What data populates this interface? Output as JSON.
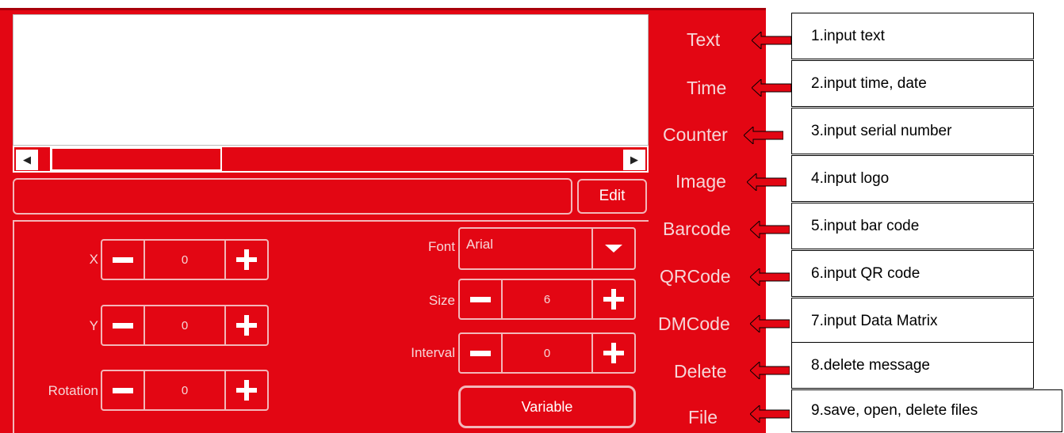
{
  "editor": {
    "scroll_left_icon": "left-arrow-icon",
    "scroll_right_icon": "right-arrow-icon",
    "edit_label": "Edit"
  },
  "props": {
    "x_label": "X",
    "x_value": "0",
    "y_label": "Y",
    "y_value": "0",
    "rotation_label": "Rotation",
    "rotation_value": "0",
    "font_label": "Font",
    "font_value": "Arial",
    "size_label": "Size",
    "size_value": "6",
    "interval_label": "Interval",
    "interval_value": "0",
    "variable_label": "Variable"
  },
  "menu": [
    "Text",
    "Time",
    "Counter",
    "Image",
    "Barcode",
    "QRCode",
    "DMCode",
    "Delete",
    "File"
  ],
  "annotations": [
    "1.input text",
    "2.input time, date",
    "3.input serial number",
    "4.input logo",
    "5.input bar code",
    "6.input QR code",
    "7.input Data Matrix",
    "8.delete message",
    "9.save, open, delete files"
  ],
  "colors": {
    "panel": "#e30613",
    "arrow": "#e30613"
  }
}
